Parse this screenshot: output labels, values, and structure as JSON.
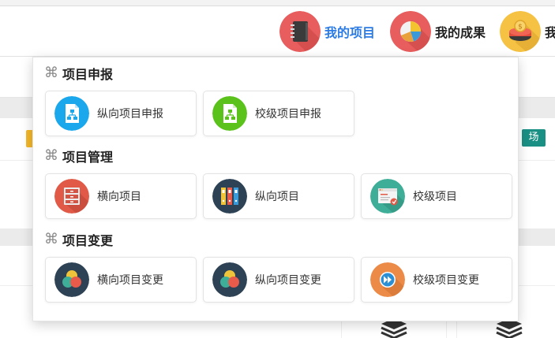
{
  "header": {
    "nav": [
      {
        "label": "我的项目",
        "icon": "notebook-icon"
      },
      {
        "label": "我的成果",
        "icon": "pie-chart-icon"
      },
      {
        "label": "我",
        "icon": "coin-bowl-icon"
      }
    ]
  },
  "background": {
    "tag_label": "场"
  },
  "dropdown": {
    "sections": [
      {
        "title": "项目申报",
        "items": [
          {
            "label": "纵向项目申报",
            "icon": "file-flowchart-icon"
          },
          {
            "label": "校级项目申报",
            "icon": "file-flowchart-icon"
          }
        ]
      },
      {
        "title": "项目管理",
        "items": [
          {
            "label": "横向项目",
            "icon": "file-cabinet-icon"
          },
          {
            "label": "纵向项目",
            "icon": "binders-icon"
          },
          {
            "label": "校级项目",
            "icon": "browser-window-icon"
          }
        ]
      },
      {
        "title": "项目变更",
        "items": [
          {
            "label": "横向项目变更",
            "icon": "color-circles-icon"
          },
          {
            "label": "纵向项目变更",
            "icon": "color-circles-icon"
          },
          {
            "label": "校级项目变更",
            "icon": "fast-forward-icon"
          }
        ]
      }
    ]
  },
  "colors": {
    "active_nav": "#2c7be5",
    "icon_blue": "#1aa7ec",
    "icon_green": "#5bc21c",
    "icon_red": "#e05a47",
    "icon_navy": "#2e4256",
    "icon_teal": "#3fae98",
    "icon_orange": "#ec8a47",
    "tag_green": "#1a8f84",
    "tag_yellow": "#f4b728"
  }
}
